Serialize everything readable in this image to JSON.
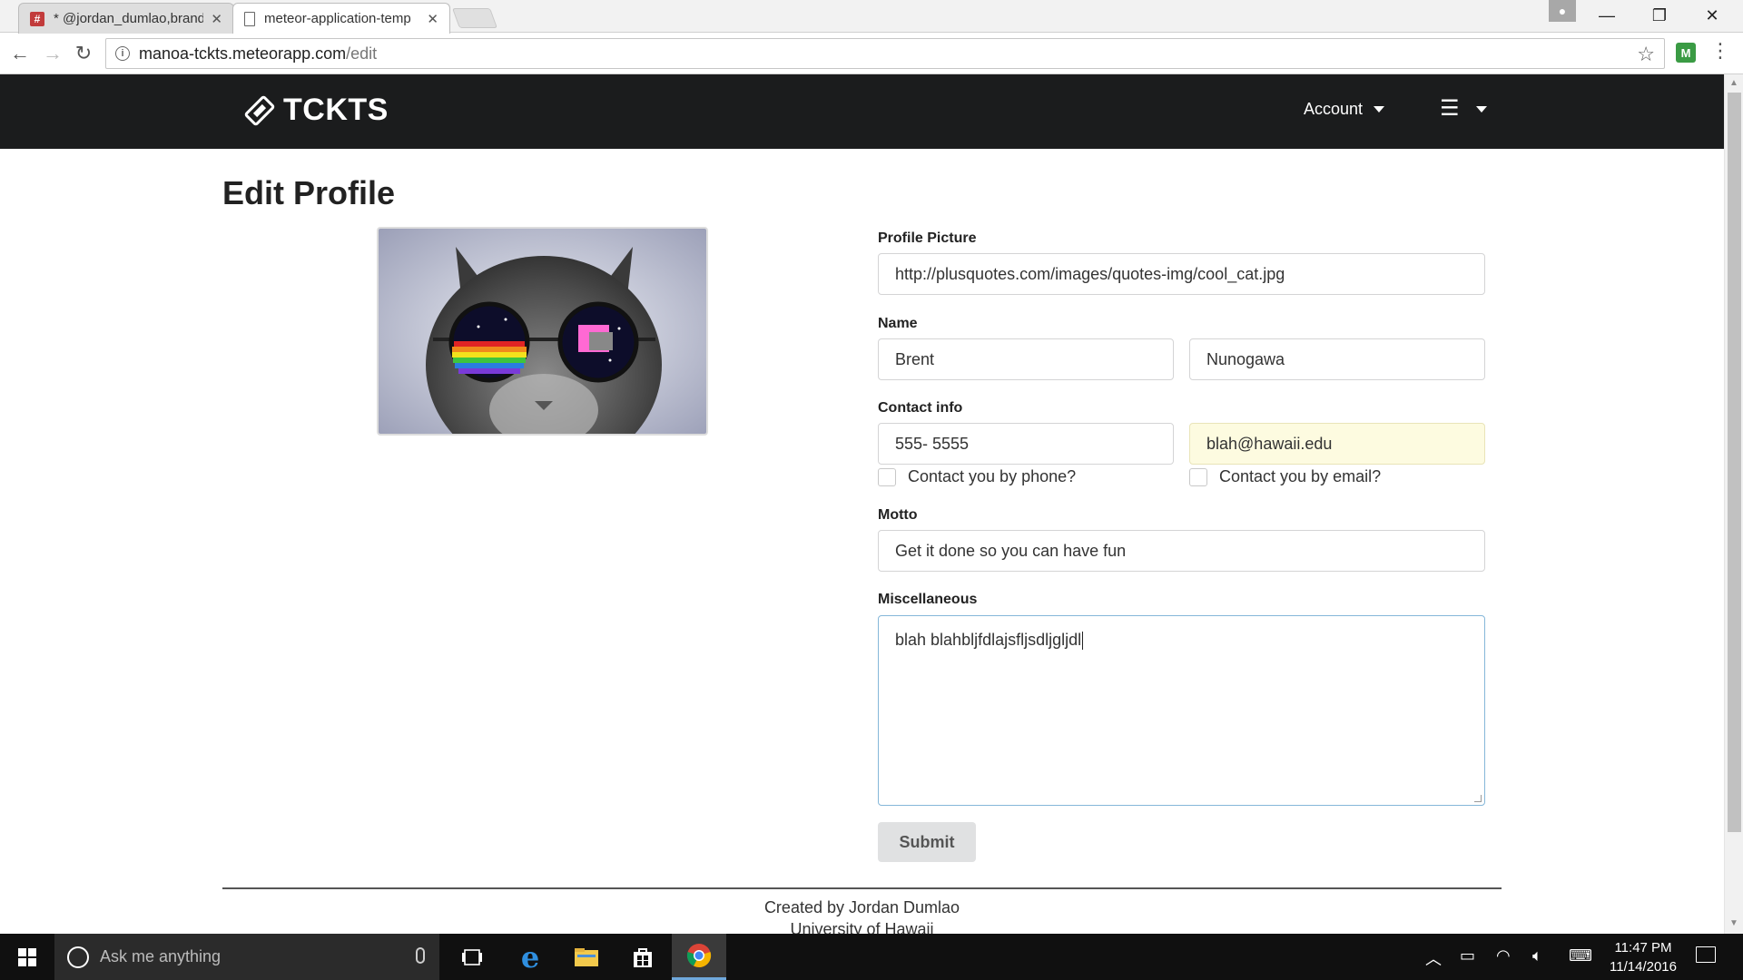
{
  "browser": {
    "tabs": [
      {
        "title": "* @jordan_dumlao,brand",
        "favicon": "slack-hash-icon"
      },
      {
        "title": "meteor-application-temp",
        "favicon": "document-icon"
      }
    ],
    "url_host": "manoa-tckts.meteorapp.com",
    "url_path": "/edit"
  },
  "site": {
    "brand": "TCKTS",
    "nav": {
      "account": "Account"
    }
  },
  "page": {
    "title": "Edit Profile",
    "form": {
      "picture_label": "Profile Picture",
      "picture_value": "http://plusquotes.com/images/quotes-img/cool_cat.jpg",
      "name_label": "Name",
      "first_name": "Brent",
      "last_name": "Nunogawa",
      "contact_label": "Contact info",
      "phone": "555- 5555",
      "email": "blah@hawaii.edu",
      "phone_check_label": "Contact you by phone?",
      "email_check_label": "Contact you by email?",
      "motto_label": "Motto",
      "motto": "Get it done so you can have fun",
      "misc_label": "Miscellaneous",
      "misc": "blah blahbljfdlajsfljsdljgljdl",
      "submit": "Submit"
    },
    "footer": {
      "line1": "Created by Jordan Dumlao",
      "line2": "University of Hawaii"
    }
  },
  "taskbar": {
    "search_placeholder": "Ask me anything",
    "time": "11:47 PM",
    "date": "11/14/2016"
  },
  "colors": {
    "navbar": "#1b1c1d",
    "autofill": "#fdfbe0",
    "focus_border": "#85b7d9"
  }
}
